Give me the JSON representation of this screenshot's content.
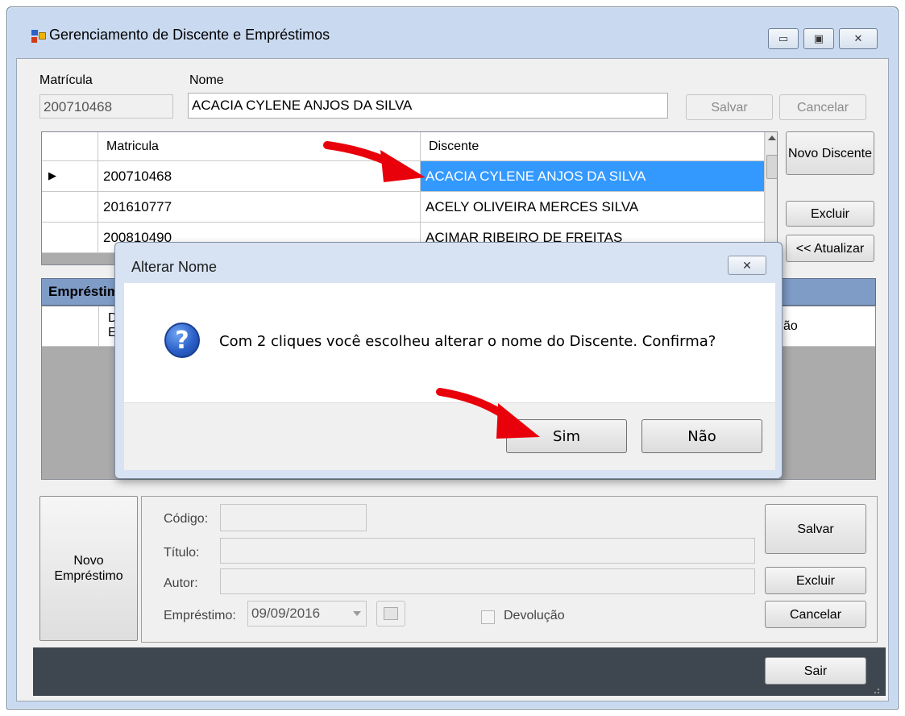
{
  "window": {
    "title": "Gerenciamento de Discente e Empréstimos",
    "controls": {
      "minimize": "▭",
      "maximize": "▣",
      "close": "✕"
    }
  },
  "top_form": {
    "matricula_label": "Matrícula",
    "matricula_value": "200710468",
    "nome_label": "Nome",
    "nome_value": "ACACIA CYLENE ANJOS DA SILVA",
    "save_label": "Salvar",
    "cancel_label": "Cancelar"
  },
  "students_grid": {
    "columns": [
      "Matricula",
      "Discente"
    ],
    "rows": [
      {
        "matricula": "200710468",
        "discente": "ACACIA CYLENE ANJOS DA SILVA",
        "selected": true
      },
      {
        "matricula": "201610777",
        "discente": "ACELY OLIVEIRA MERCES SILVA",
        "selected": false
      },
      {
        "matricula": "200810490",
        "discente": "ACIMAR RIBEIRO DE FREITAS",
        "selected": false
      }
    ],
    "current_row_marker": "▶"
  },
  "side_buttons": {
    "novo_discente": "Novo Discente",
    "excluir": "Excluir",
    "atualizar": "<< Atualizar"
  },
  "loans_section": {
    "title": "Empréstimos",
    "visible_header_fragments": {
      "col1_line1": "D",
      "col1_line2": "E",
      "last_col": "ão"
    }
  },
  "loan_form": {
    "novo_emprestimo": "Novo Empréstimo",
    "codigo_label": "Código:",
    "titulo_label": "Título:",
    "autor_label": "Autor:",
    "emprestimo_label": "Empréstimo:",
    "emprestimo_date": "09/09/2016",
    "devolucao_label": "Devolução",
    "salvar": "Salvar",
    "excluir": "Excluir",
    "cancelar": "Cancelar"
  },
  "footer": {
    "sair": "Sair"
  },
  "dialog": {
    "title": "Alterar Nome",
    "close": "✕",
    "message": "Com 2 cliques você escolheu alterar o nome do Discente. Confirma?",
    "icon": "question-icon",
    "icon_glyph": "?",
    "yes": "Sim",
    "no": "Não"
  },
  "colors": {
    "selection": "#3399ff",
    "section_header": "#7f9cc7",
    "footer_bar": "#3e474f",
    "annotation_arrow": "#e8000b"
  }
}
